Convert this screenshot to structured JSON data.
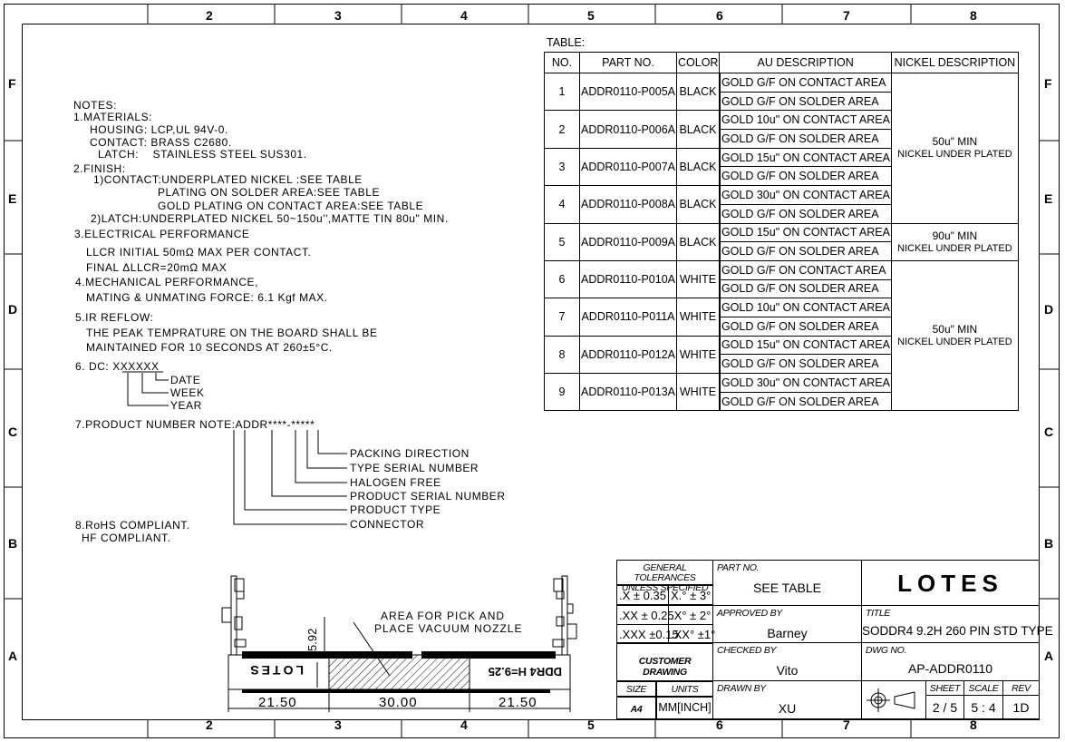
{
  "zones": {
    "columns": [
      "2",
      "3",
      "4",
      "5",
      "6",
      "7",
      "8"
    ],
    "rows": [
      "F",
      "E",
      "D",
      "C",
      "B",
      "A"
    ]
  },
  "notes": {
    "lines": [
      "NOTES:",
      "1.MATERIALS:",
      "HOUSING: LCP,UL 94V-0.",
      "CONTACT: BRASS C2680.",
      "LATCH:    STAINLESS STEEL SUS301.",
      "2.FINISH:",
      "1)CONTACT:UNDERPLATED NICKEL :SEE TABLE",
      "PLATING ON SOLDER AREA:SEE TABLE",
      "GOLD PLATING ON CONTACT AREA:SEE TABLE",
      "2)LATCH:UNDERPLATED NICKEL 50~150u'',MATTE TIN 80u\" MIN.",
      "3.ELECTRICAL PERFORMANCE",
      "LLCR INITIAL 50mΩ MAX PER CONTACT.",
      "FINAL ΔLLCR=20mΩ MAX",
      "4.MECHANICAL PERFORMANCE,",
      "MATING & UNMATING FORCE: 6.1 Kgf MAX.",
      "5.IR REFLOW:",
      "THE PEAK TEMPRATURE ON THE BOARD SHALL BE",
      "MAINTAINED FOR 10 SECONDS AT 260±5°C.",
      "6. DC: XXXXXX",
      "7.PRODUCT NUMBER NOTE:ADDR****-*****",
      "8.RoHS COMPLIANT.",
      "HF COMPLIANT."
    ],
    "dc_labels": [
      "DATE",
      "WEEK",
      "YEAR"
    ],
    "pn_labels": [
      "PACKING DIRECTION",
      "TYPE SERIAL NUMBER",
      "HALOGEN FREE",
      "PRODUCT SERIAL NUMBER",
      "PRODUCT TYPE",
      "CONNECTOR"
    ]
  },
  "table": {
    "caption": "TABLE:",
    "headers": [
      "NO.",
      "PART NO.",
      "COLOR",
      "AU DESCRIPTION",
      "NICKEL DESCRIPTION"
    ],
    "rows": [
      {
        "no": "1",
        "part": "ADDR0110-P005A",
        "color": "BLACK",
        "au": [
          "GOLD G/F ON CONTACT AREA",
          "GOLD G/F ON SOLDER AREA"
        ]
      },
      {
        "no": "2",
        "part": "ADDR0110-P006A",
        "color": "BLACK",
        "au": [
          "GOLD 10u\" ON CONTACT AREA",
          "GOLD G/F ON SOLDER AREA"
        ]
      },
      {
        "no": "3",
        "part": "ADDR0110-P007A",
        "color": "BLACK",
        "au": [
          "GOLD 15u\" ON CONTACT AREA",
          "GOLD G/F ON SOLDER AREA"
        ]
      },
      {
        "no": "4",
        "part": "ADDR0110-P008A",
        "color": "BLACK",
        "au": [
          "GOLD 30u\" ON CONTACT AREA",
          "GOLD G/F ON SOLDER AREA"
        ]
      },
      {
        "no": "5",
        "part": "ADDR0110-P009A",
        "color": "BLACK",
        "au": [
          "GOLD 15u\" ON CONTACT AREA",
          "GOLD G/F ON SOLDER AREA"
        ]
      },
      {
        "no": "6",
        "part": "ADDR0110-P010A",
        "color": "WHITE",
        "au": [
          "GOLD G/F ON CONTACT AREA",
          "GOLD G/F ON SOLDER AREA"
        ]
      },
      {
        "no": "7",
        "part": "ADDR0110-P011A",
        "color": "WHITE",
        "au": [
          "GOLD 10u\" ON CONTACT AREA",
          "GOLD G/F ON SOLDER AREA"
        ]
      },
      {
        "no": "8",
        "part": "ADDR0110-P012A",
        "color": "WHITE",
        "au": [
          "GOLD 15u\" ON CONTACT AREA",
          "GOLD G/F ON SOLDER AREA"
        ]
      },
      {
        "no": "9",
        "part": "ADDR0110-P013A",
        "color": "WHITE",
        "au": [
          "GOLD 30u\" ON CONTACT AREA",
          "GOLD G/F ON SOLDER AREA"
        ]
      }
    ],
    "nickel_groups": [
      {
        "rows": 4,
        "lines": [
          "50u\" MIN",
          "NICKEL UNDER PLATED"
        ]
      },
      {
        "rows": 1,
        "lines": [
          "90u\" MIN",
          "NICKEL UNDER PLATED"
        ]
      },
      {
        "rows": 4,
        "lines": [
          "50u\" MIN",
          "NICKEL UNDER PLATED"
        ]
      }
    ]
  },
  "drawing": {
    "callout": [
      "AREA FOR PICK AND",
      "PLACE VACUUM NOZZLE"
    ],
    "height_dim": "5.92",
    "dims": [
      "21.50",
      "30.00",
      "21.50"
    ],
    "left_marking": "LOTES",
    "right_marking": "DDR4 H=9.25"
  },
  "title_block": {
    "tolerances_header": [
      "GENERAL TOLERANCES",
      "UNLESS SPECIFIED"
    ],
    "tolerances": [
      [
        ".X ± 0.35",
        "X.° ± 3°"
      ],
      [
        ".XX ± 0.25",
        ".X° ± 2°"
      ],
      [
        ".XXX ±0.15",
        ".XX° ±1°"
      ]
    ],
    "customer_drawing": "CUSTOMER DRAWING",
    "size_label": "SIZE",
    "size": "A4",
    "units_label": "UNITS",
    "units": "MM[INCH]",
    "part_no_label": "PART NO.",
    "part_no": "SEE TABLE",
    "approved_label": "APPROVED BY",
    "approved": "Barney",
    "checked_label": "CHECKED BY",
    "checked": "Vito",
    "drawn_label": "DRAWN BY",
    "drawn": "XU",
    "logo": "LOTES",
    "title_label": "TITLE",
    "title": "SODDR4 9.2H 260 PIN STD TYPE",
    "dwg_label": "DWG NO.",
    "dwg": "AP-ADDR0110",
    "sheet_label": "SHEET",
    "sheet": "2 / 5",
    "scale_label": "SCALE",
    "scale": "5 : 4",
    "rev_label": "REV",
    "rev": "1D",
    "projection_icon": "third-angle-projection-icon"
  }
}
